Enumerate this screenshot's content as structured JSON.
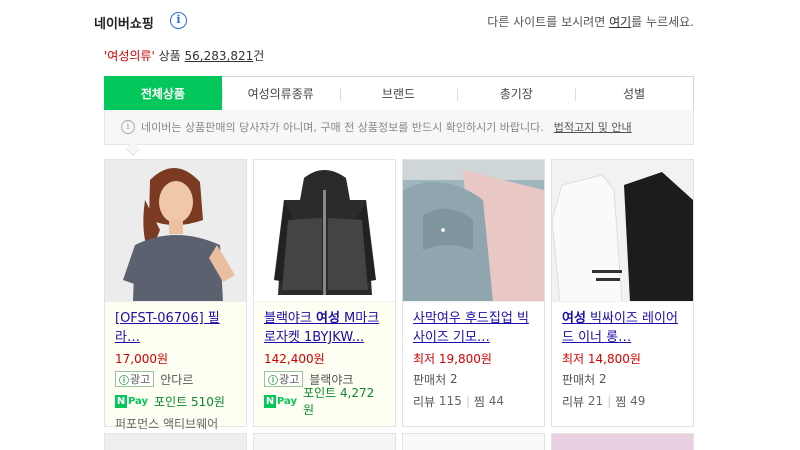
{
  "header": {
    "brand": "네이버쇼핑",
    "info_icon": "info-icon",
    "notice_prefix": "다른 사이트를 보시려면",
    "notice_link": "여기",
    "notice_suffix": "를 누르세요."
  },
  "summary": {
    "query": "'여성의류'",
    "label": "상품",
    "count": "56,283,821",
    "unit": "건"
  },
  "tabs": [
    {
      "label": "전체상품",
      "active": true
    },
    {
      "label": "여성의류종류",
      "active": false
    },
    {
      "label": "브랜드",
      "active": false
    },
    {
      "label": "총기장",
      "active": false
    },
    {
      "label": "성별",
      "active": false
    }
  ],
  "disclaimer": {
    "text": "네이버는 상품판매의 당사자가 아니며, 구매 전 상품정보를 반드시 확인하시기 바랍니다.",
    "link": "법적고지 및 안내"
  },
  "products": [
    {
      "title": "[OFST-06706] 필라…",
      "price": "17,000원",
      "ad_label": "광고",
      "seller": "안다르",
      "pay_label": "Pay",
      "points": "포인트 510원",
      "store": "퍼포먼스 액티브웨어"
    },
    {
      "title_pre": "블랙야크 ",
      "title_bold": "여성",
      "title_post": " M마크로자켓 1BYJKW...",
      "price": "142,400원",
      "ad_label": "광고",
      "seller": "블랙야크",
      "pay_label": "Pay",
      "points": "포인트 4,272원"
    },
    {
      "title": "사막여우 후드집업 빅사이즈 기모…",
      "price": "최저 19,800원",
      "sellers_label": "판매처",
      "sellers": "2",
      "review_label": "리뷰",
      "reviews": "115",
      "zzim_label": "찜",
      "zzim": "44"
    },
    {
      "title_bold": "여성",
      "title_post": " 빅싸이즈 레이어드 이너 롱…",
      "price": "최저 14,800원",
      "sellers_label": "판매처",
      "sellers": "2",
      "review_label": "리뷰",
      "reviews": "21",
      "zzim_label": "찜",
      "zzim": "49"
    }
  ],
  "colors": {
    "accent_green": "#03c75a",
    "price_red": "#d60000",
    "link_blue": "#1a0dab"
  }
}
